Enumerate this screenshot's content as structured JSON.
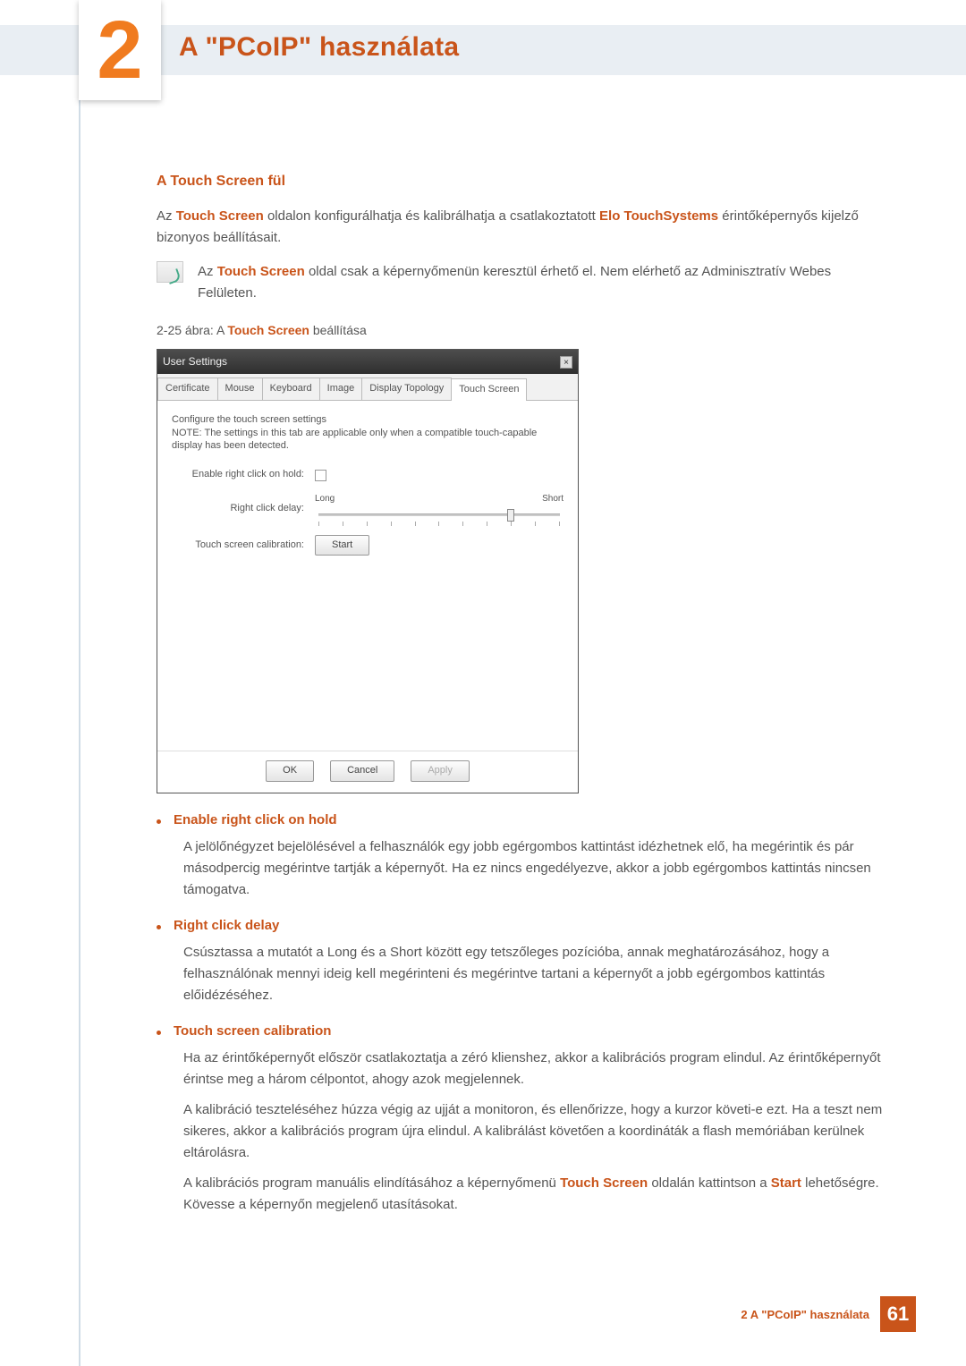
{
  "chapter": {
    "number": "2",
    "title": "A \"PCoIP\" használata"
  },
  "section": {
    "title": "A Touch Screen fül",
    "intro_pre": "Az ",
    "intro_bold1": "Touch Screen",
    "intro_mid": " oldalon konfigurálhatja és kalibrálhatja a csatlakoztatott  ",
    "intro_bold2": "Elo TouchSystems",
    "intro_post": " érintőképernyős kijelző bizonyos beállításait."
  },
  "note": {
    "pre": "Az ",
    "bold": "Touch Screen",
    "post": " oldal csak a képernyőmenün keresztül érhető el. Nem elérhető az Adminisztratív Webes Felületen."
  },
  "figure": {
    "label_pre": "2-25 ábra: A ",
    "label_bold": "Touch Screen",
    "label_post": " beállítása"
  },
  "dialog": {
    "title": "User Settings",
    "tabs": [
      "Certificate",
      "Mouse",
      "Keyboard",
      "Image",
      "Display Topology",
      "Touch Screen"
    ],
    "active_tab": 5,
    "intro1": "Configure the touch screen settings",
    "intro2": "NOTE: The settings in this tab are applicable only when a compatible touch-capable display has been detected.",
    "row1_label": "Enable right click on hold:",
    "row2_label": "Right click delay:",
    "slider_left": "Long",
    "slider_right": "Short",
    "row3_label": "Touch screen calibration:",
    "start_btn": "Start",
    "ok_btn": "OK",
    "cancel_btn": "Cancel",
    "apply_btn": "Apply"
  },
  "bullets": {
    "b1": {
      "title": "Enable right click on hold",
      "text": "A jelölőnégyzet bejelölésével a felhasználók egy jobb egérgombos kattintást idézhetnek elő, ha megérintik és pár másodpercig megérintve tartják a képernyőt. Ha ez nincs engedélyezve, akkor a jobb egérgombos kattintás nincsen támogatva."
    },
    "b2": {
      "title": "Right click delay",
      "text": "Csúsztassa a mutatót a Long és a Short között egy tetszőleges pozícióba, annak meghatározásához, hogy a felhasználónak mennyi ideig kell megérinteni és megérintve tartani a képernyőt a jobb egérgombos kattintás előidézéséhez."
    },
    "b3": {
      "title": "Touch screen calibration",
      "text1": "Ha az érintőképernyőt először csatlakoztatja a zéró klienshez, akkor a kalibrációs program elindul. Az érintőképernyőt érintse meg a három célpontot, ahogy azok megjelennek.",
      "text2": "A kalibráció teszteléséhez húzza végig az ujját a monitoron, és ellenőrizze, hogy a kurzor követi-e ezt. Ha a teszt nem sikeres, akkor a kalibrációs program újra elindul. A kalibrálást követően a koordináták a flash memóriában kerülnek eltárolásra.",
      "text3_pre": "A kalibrációs program manuális elindításához a képernyőmenü ",
      "text3_bold1": "Touch Screen",
      "text3_mid": " oldalán kattintson a ",
      "text3_bold2": "Start",
      "text3_post": " lehetőségre. Kövesse a képernyőn megjelenő utasításokat."
    }
  },
  "footer": {
    "text": "2 A \"PCoIP\" használata",
    "page": "61"
  }
}
